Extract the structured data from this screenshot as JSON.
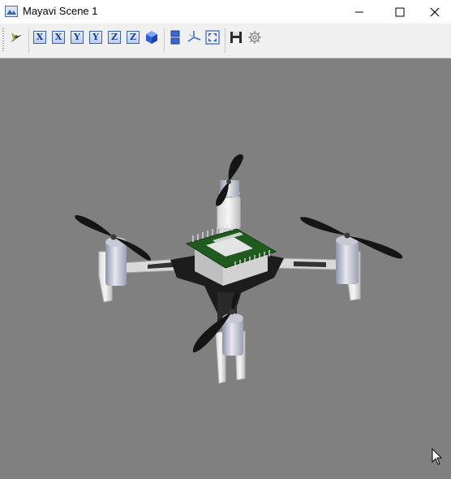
{
  "window": {
    "title": "Mayavi Scene 1",
    "icon": "mayavi-scene-icon",
    "controls": [
      "minimize-icon",
      "maximize-icon",
      "close-icon"
    ]
  },
  "toolbar": {
    "buttons": [
      {
        "name": "mayavi-pipeline-icon"
      },
      {
        "name": "view-x-positive-button",
        "text": "X"
      },
      {
        "name": "view-x-negative-button",
        "text": "X"
      },
      {
        "name": "view-y-positive-button",
        "text": "Y"
      },
      {
        "name": "view-y-negative-button",
        "text": "Y"
      },
      {
        "name": "view-z-positive-button",
        "text": "Z"
      },
      {
        "name": "view-z-negative-button",
        "text": "Z"
      },
      {
        "name": "isometric-view-icon"
      },
      {
        "name": "parallel-projection-icon"
      },
      {
        "name": "axes-toggle-icon"
      },
      {
        "name": "full-screen-icon"
      },
      {
        "name": "save-icon"
      },
      {
        "name": "configure-icon"
      }
    ]
  },
  "scene": {
    "background": "#808080",
    "object": "quadcopter-model",
    "colors": {
      "frame": "#1c1c1c",
      "propellers": "#151515",
      "motors": "#c9ccd6",
      "board": "#1f5a1f",
      "pins": "#d4d4d4"
    }
  }
}
